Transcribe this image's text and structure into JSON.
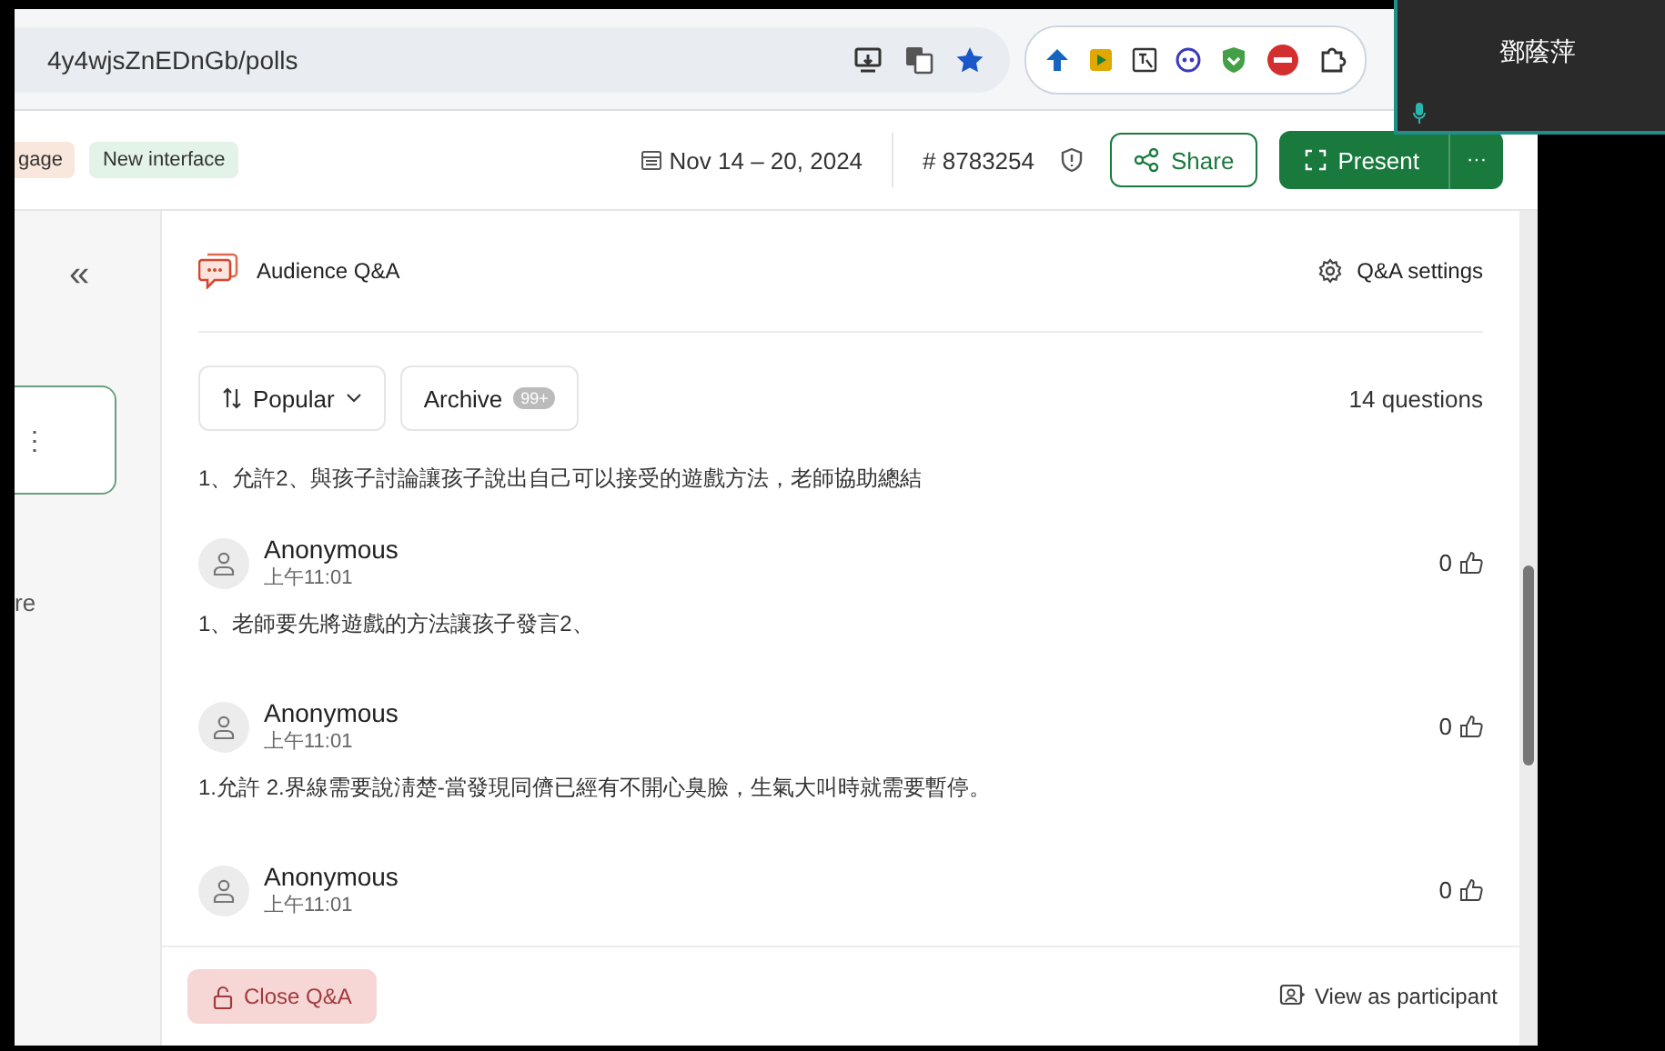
{
  "browser": {
    "url": "4y4wjsZnEDnGb/polls"
  },
  "video_tile": {
    "name": "鄧蔭萍"
  },
  "toolbar": {
    "tags": [
      {
        "label": "gage",
        "color": "#f9e6dc"
      },
      {
        "label": "New interface",
        "color": "#e4f3e8"
      }
    ],
    "date": "Nov 14 – 20, 2024",
    "code": "# 8783254",
    "share": "Share",
    "present": "Present",
    "more": "···"
  },
  "sidebar": {
    "collapse": "«",
    "menu": "⋮",
    "label": "re"
  },
  "qa": {
    "title": "Audience Q&A",
    "settings": "Q&A settings",
    "sort": "Popular",
    "archive": "Archive",
    "archive_count": "99+",
    "count": "14 questions",
    "lead_text": "1、允許2、與孩子討論讓孩子說出自己可以接受的遊戲方法，老師協助總結",
    "questions": [
      {
        "author": "Anonymous",
        "time": "上午11:01",
        "votes": "0",
        "text": "1、老師要先將遊戲的方法讓孩子發言2、"
      },
      {
        "author": "Anonymous",
        "time": "上午11:01",
        "votes": "0",
        "text": "1.允許 2.界線需要說淸楚-當發現同儕已經有不開心臭臉，生氣大叫時就需要暫停。"
      },
      {
        "author": "Anonymous",
        "time": "上午11:01",
        "votes": "0"
      }
    ],
    "close": "Close Q&A",
    "view": "View as participant"
  }
}
